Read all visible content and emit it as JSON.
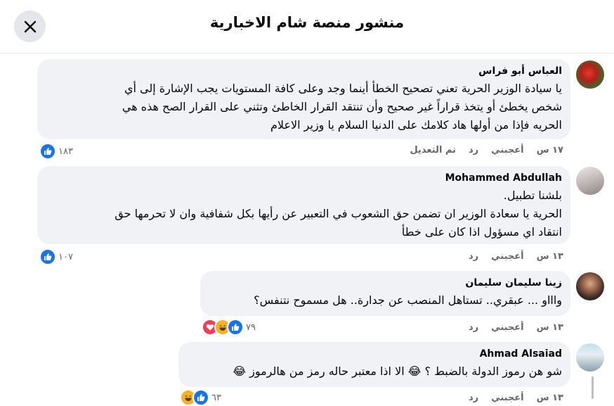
{
  "header": {
    "title": "منشور منصة شام الاخبارية"
  },
  "comments": [
    {
      "author": "العباس أبو فراس",
      "lines": [
        "يا سيادة الوزير الحرية تعني تصحيح الخطأ أينما وجد وعلى كافة المستويات يجب الإشارة إلى أي",
        "شخص يخطئ أو يتخذ قراراً غير صحيح وأن تنتقد القرار الخاطئ وتثني على القرار الصح هذه هي",
        "الحريه فإذا من أولها هاد كلامك على الدنيا السلام يا وزير الاعلام"
      ],
      "time": "١٧ س",
      "like": "أعجبني",
      "reply": "رد",
      "edited": "تم التعديل",
      "reaction_count": "١٨٣"
    },
    {
      "author": "Mohammed Abdullah",
      "lines": [
        "بلشنا تطبيل.",
        "الحرية يا سعادة الوزير ان تضمن حق الشعوب في التعبير عن رأيها بكل شفافية وان لا تحرمها حق",
        "انتقاد اي مسؤول اذا كان على خطأ"
      ],
      "time": "١٣ س",
      "like": "أعجبني",
      "reply": "رد",
      "reaction_count": "١٠٧"
    },
    {
      "author": "زينا سليمان سليمان",
      "lines": [
        "واااو ... عبقري.. تستاهل المنصب عن جدارة.. هل مسموح نتنفس؟"
      ],
      "time": "١٣ س",
      "like": "أعجبني",
      "reply": "رد",
      "reaction_count": "٧٩"
    },
    {
      "author": "Ahmad Alsaiad",
      "lines": [
        "شو هن رموز الدولة بالضبط ؟ 😂 الا اذا معتبر حاله رمز من هالرموز 😂"
      ],
      "time": "١٣ س",
      "like": "أعجبني",
      "reply": "رد",
      "reaction_count": "٦٣"
    }
  ],
  "icons": {
    "close": "close-icon",
    "like": "like-reaction-icon",
    "love": "love-reaction-icon",
    "haha": "haha-reaction-icon"
  },
  "colors": {
    "like_blue": "#1b74e4",
    "love_red": "#f33e58",
    "haha_yellow": "#f7b125",
    "bubble": "#f0f2f5",
    "muted": "#65676b"
  }
}
